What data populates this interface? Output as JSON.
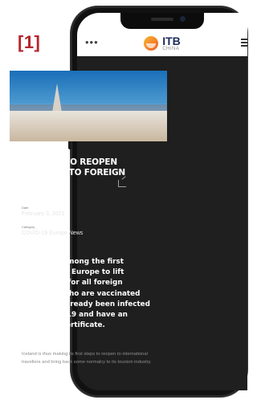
{
  "figure": {
    "label": "[1]"
  },
  "header": {
    "dots": "•••",
    "logo": {
      "brand": "ITB",
      "sub": "CHINA"
    }
  },
  "article": {
    "title": "ICELAND TO REOPEN BORDERS TO FOREIGN TOURISTS",
    "date_label": "Date",
    "date": "February 3, 2021",
    "category_label": "Category",
    "category": "COVID-19 Europe News",
    "lead": "Iceland is among the first countries in Europe to lift quarantine for all foreign travellers who are vaccinated or who've already been infected with Covid-19 and have an immunity certificate.",
    "body": "Iceland is thus making its first steps to reopen to international travellers and bring back some normalcy to its tourism industry."
  },
  "colors": {
    "label_red": "#b5262b",
    "screen_bg": "#1f1f1f",
    "brand_navy": "#1d2b5a",
    "brand_orange": "#f15a24"
  },
  "icons": [
    "more-dots-icon",
    "hamburger-menu-icon",
    "share-icon",
    "itb-logo"
  ]
}
